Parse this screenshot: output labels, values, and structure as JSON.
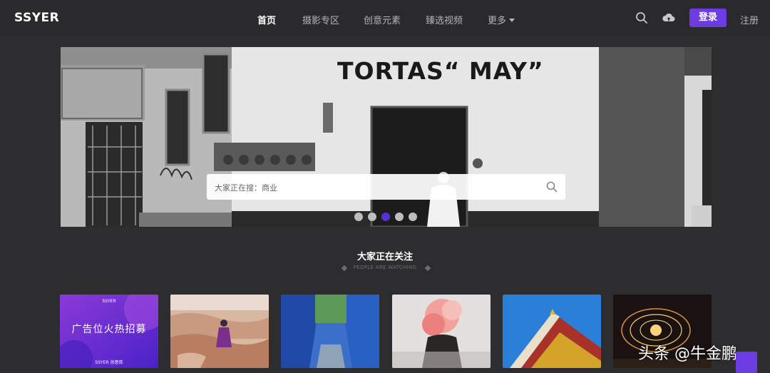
{
  "header": {
    "logo": "SSYER",
    "nav": [
      {
        "label": "首页",
        "active": true
      },
      {
        "label": "摄影专区",
        "active": false
      },
      {
        "label": "创意元素",
        "active": false
      },
      {
        "label": "臻选视频",
        "active": false
      },
      {
        "label": "更多",
        "active": false,
        "dropdown": true
      }
    ],
    "search_icon": "search-icon",
    "upload_icon": "cloud-upload-icon",
    "login_label": "登录",
    "register_label": "注册"
  },
  "banner": {
    "sign_text": "TORTAS“ MAY”",
    "search_placeholder": "大家正在搜：商业",
    "carousel": {
      "count": 5,
      "active_index": 2
    }
  },
  "section": {
    "title": "大家正在关注",
    "subtitle": "PEOPLE ARE WATCHING"
  },
  "thumbnails": [
    {
      "kind": "ad",
      "title": "广告位火热招募",
      "logo": "SSYER",
      "footer": "SSYER 创意库"
    },
    {
      "kind": "photo",
      "subject": "desert-hiker"
    },
    {
      "kind": "photo",
      "subject": "blue-alley"
    },
    {
      "kind": "photo",
      "subject": "pink-smoke"
    },
    {
      "kind": "photo",
      "subject": "temple-roof"
    },
    {
      "kind": "photo",
      "subject": "fire-sparks"
    }
  ],
  "watermark": "头条 @牛金鹏",
  "colors": {
    "accent": "#6c3ce2",
    "background": "#2d2d2f",
    "header": "#2a2a2c"
  }
}
